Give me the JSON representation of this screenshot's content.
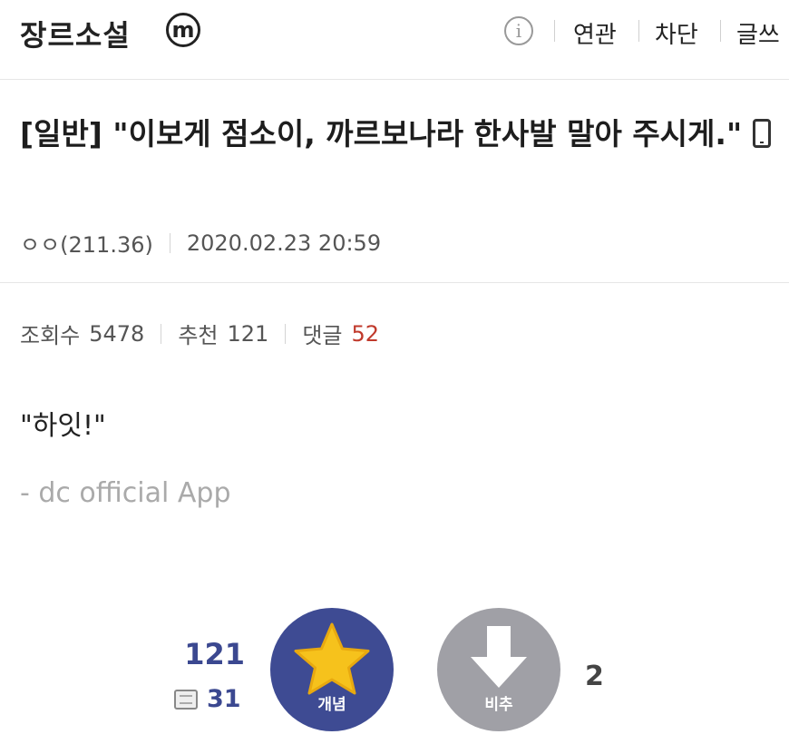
{
  "header": {
    "gallery_name": "장르소설",
    "badge": "m",
    "info_symbol": "i",
    "buttons": [
      "연관",
      "차단",
      "글쓰"
    ]
  },
  "post": {
    "category": "[일반]",
    "title": "\"이보게 점소이, 까르보나라 한사발 말아 주시게.\"",
    "writer": "ㅇㅇ(211.36)",
    "date": "2020.02.23 20:59",
    "stats": {
      "views_label": "조회수",
      "views": "5478",
      "recommend_label": "추천",
      "recommend": "121",
      "comments_label": "댓글",
      "comments": "52"
    },
    "body": "\"하잇!\"",
    "signature": "- dc official App"
  },
  "vote": {
    "up_count": "121",
    "fixed_count": "31",
    "up_label": "개념",
    "down_label": "비추",
    "down_count": "2",
    "colors": {
      "up": "#3e4b93",
      "down": "#a0a0a6",
      "star": "#f6c21c"
    }
  }
}
